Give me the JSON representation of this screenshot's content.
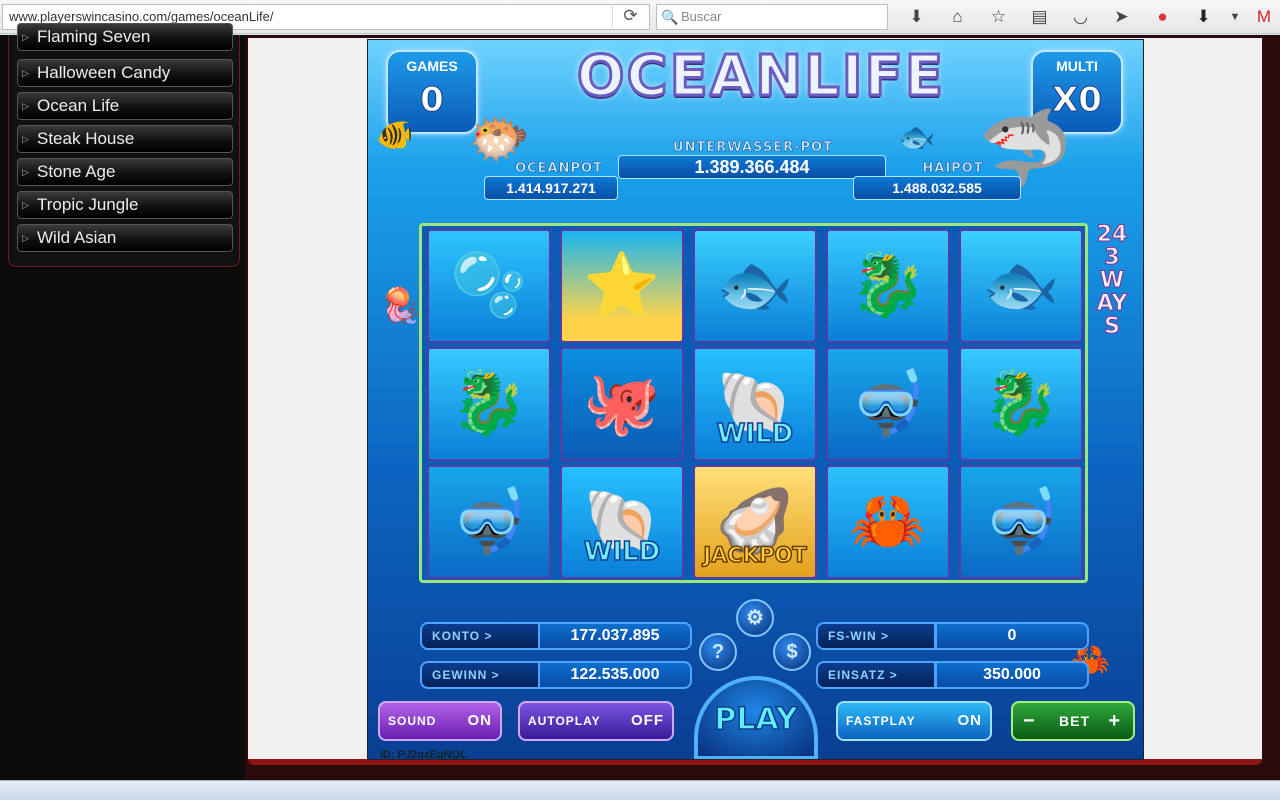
{
  "browser": {
    "url": "www.playerswincasino.com/games/oceanLife/",
    "search_placeholder": "Buscar"
  },
  "sidebar": {
    "items": [
      {
        "label": "Flaming Seven"
      },
      {
        "label": "Halloween Candy"
      },
      {
        "label": "Ocean Life"
      },
      {
        "label": "Steak House"
      },
      {
        "label": "Stone Age"
      },
      {
        "label": "Tropic Jungle"
      },
      {
        "label": "Wild Asian"
      }
    ]
  },
  "game": {
    "title": "OCEANLIFE",
    "games_label": "GAMES",
    "games_value": "0",
    "multi_label": "MULTI",
    "multi_value": "X0",
    "pots": {
      "center_label": "UNTERWASSER-POT",
      "center_value": "1.389.366.484",
      "left_label": "OCEANPOT",
      "left_value": "1.414.917.271",
      "right_label": "HAIPOT",
      "right_value": "1.488.032.585"
    },
    "ways_label": "243WAYS",
    "reels": [
      [
        {
          "symbol": "bubbles",
          "glyph": "🫧"
        },
        {
          "symbol": "seahorse",
          "glyph": "🐉"
        },
        {
          "symbol": "diver",
          "glyph": "🤿"
        }
      ],
      [
        {
          "symbol": "starfish",
          "glyph": "⭐"
        },
        {
          "symbol": "octopus",
          "glyph": "🐙"
        },
        {
          "symbol": "wild",
          "glyph": "🐚",
          "tag": "WILD"
        }
      ],
      [
        {
          "symbol": "stingray",
          "glyph": "🐟"
        },
        {
          "symbol": "wild",
          "glyph": "🐚",
          "tag": "WILD"
        },
        {
          "symbol": "jackpot",
          "glyph": "🦪",
          "tag": "JACKPOT"
        }
      ],
      [
        {
          "symbol": "seahorse",
          "glyph": "🐉"
        },
        {
          "symbol": "diver",
          "glyph": "🤿"
        },
        {
          "symbol": "crab",
          "glyph": "🦀"
        }
      ],
      [
        {
          "symbol": "stingray",
          "glyph": "🐟"
        },
        {
          "symbol": "seahorse",
          "glyph": "🐉"
        },
        {
          "symbol": "diver",
          "glyph": "🤿"
        }
      ]
    ],
    "stats": {
      "konto_label": "KONTO >",
      "konto_value": "177.037.895",
      "gewinn_label": "GEWINN >",
      "gewinn_value": "122.535.000",
      "fswin_label": "FS-WIN >",
      "fswin_value": "0",
      "einsatz_label": "EINSATZ >",
      "einsatz_value": "350.000"
    },
    "buttons": {
      "sound_label": "SOUND",
      "sound_state": "ON",
      "autoplay_label": "AUTOPLAY",
      "autoplay_state": "OFF",
      "play_label": "PLAY",
      "fastplay_label": "FASTPLAY",
      "fastplay_state": "ON",
      "bet_minus": "−",
      "bet_label": "BET",
      "bet_plus": "+",
      "settings_glyph": "⚙",
      "help_glyph": "?",
      "paytable_glyph": "$"
    },
    "game_id": "ID: PJ2gzEgNQL"
  },
  "colors": {
    "accent_red": "#8e1414",
    "reel_border": "#9ee67a",
    "game_blue": "#0c64c2"
  }
}
